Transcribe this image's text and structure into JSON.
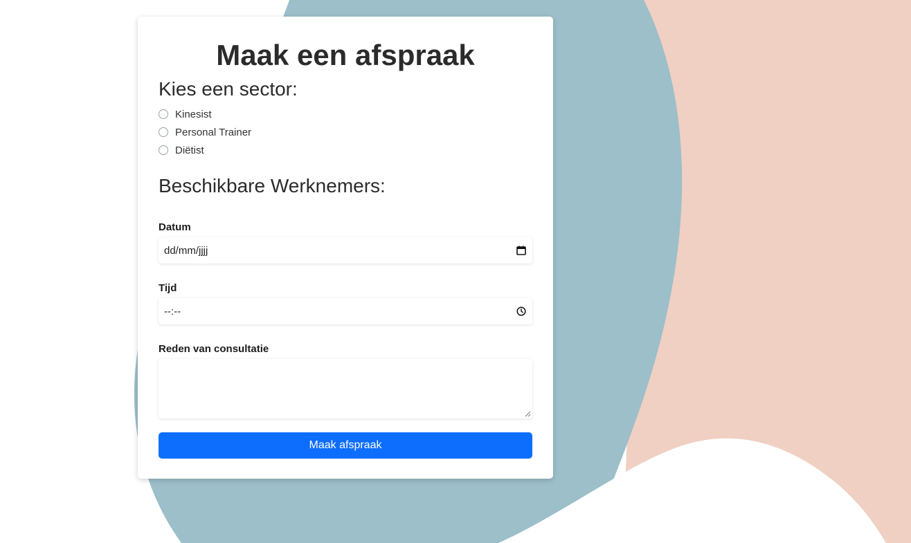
{
  "colors": {
    "blob_blue": "#9cbfca",
    "blob_peach": "#f0d0c2",
    "button_blue": "#0d6efd",
    "card_bg": "#ffffff"
  },
  "form": {
    "title": "Maak een afspraak",
    "sector_heading": "Kies een sector:",
    "sectors": [
      {
        "label": "Kinesist",
        "checked": false
      },
      {
        "label": "Personal Trainer",
        "checked": false
      },
      {
        "label": "Diëtist",
        "checked": false
      }
    ],
    "workers_heading": "Beschikbare Werknemers:",
    "date": {
      "label": "Datum",
      "placeholder": "dd/mm/jjjj",
      "icon": "calendar-icon"
    },
    "time": {
      "label": "Tijd",
      "placeholder": "--:--",
      "icon": "clock-icon"
    },
    "reason": {
      "label": "Reden van consultatie",
      "value": ""
    },
    "submit_label": "Maak afspraak"
  }
}
